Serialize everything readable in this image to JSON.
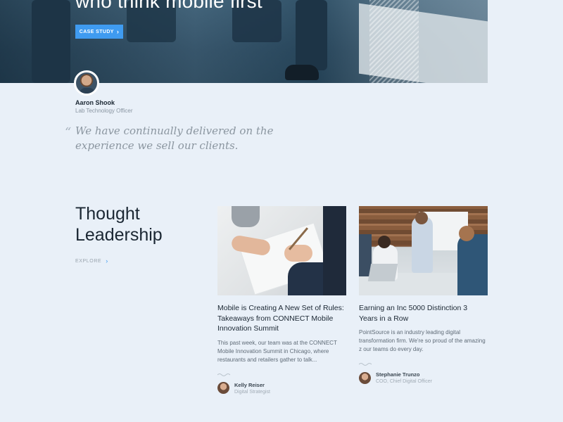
{
  "hero": {
    "title": "who think mobile first",
    "button_label": "CASE STUDY",
    "button_icon": "chevron-right-icon"
  },
  "testimonial": {
    "name": "Aaron Shook",
    "role": "Lab Technology Officer",
    "quote_mark": "“",
    "quote": "We have continually delivered on the experience we sell our clients."
  },
  "thought_leadership": {
    "title": "Thought Leadership",
    "explore_label": "EXPLORE",
    "explore_icon": "chevron-right-icon",
    "accent_color": "#3f9bf0",
    "articles": [
      {
        "title": "Mobile is Creating A New Set of Rules: Takeaways from CONNECT Mobile Innovation Summit",
        "excerpt": "This past week, our team was at the CONNECT Mobile Innovation Summit in Chicago, where restaurants and retailers gather to talk...",
        "author_name": "Kelly Reiser",
        "author_role": "Digital Strategist"
      },
      {
        "title": "Earning an Inc 5000 Distinction 3 Years in a Row",
        "excerpt": "PointSource is an industry leading digital transformation firm. We're so proud of the amazing z our teams do every day.",
        "author_name": "Stephanie Trunzo",
        "author_role": "COO, Chief Digital Officer"
      }
    ]
  }
}
